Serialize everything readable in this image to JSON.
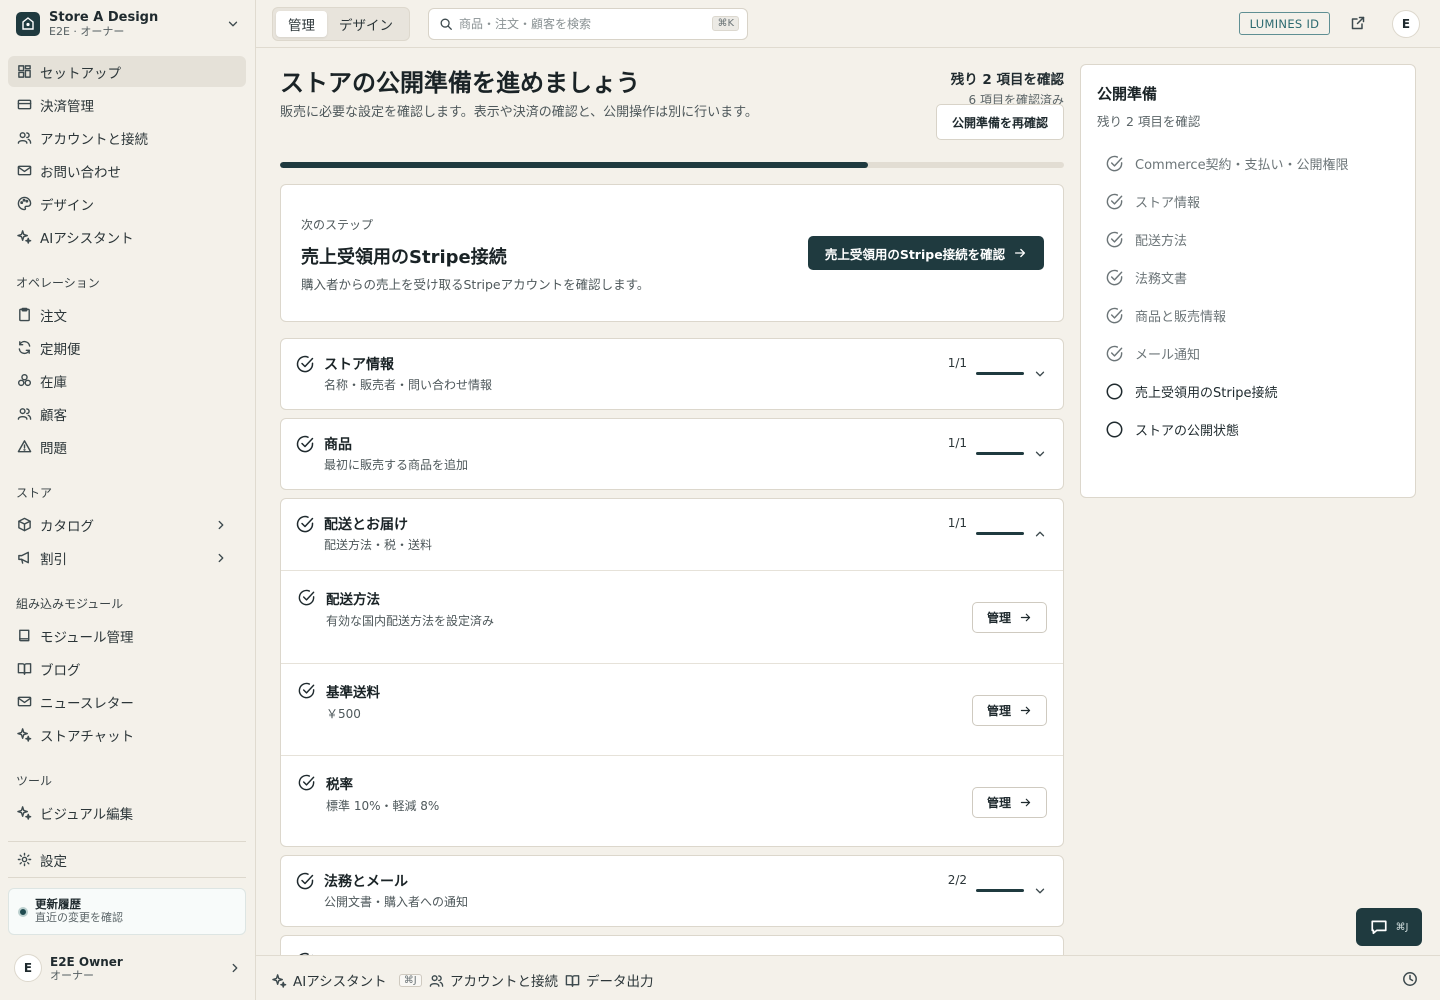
{
  "store": {
    "name": "Store A Design",
    "subtitle": "E2E · オーナー"
  },
  "sidebar": {
    "items": [
      {
        "label": "セットアップ"
      },
      {
        "label": "決済管理"
      },
      {
        "label": "アカウントと接続"
      },
      {
        "label": "お問い合わせ"
      },
      {
        "label": "デザイン"
      },
      {
        "label": "AIアシスタント"
      }
    ],
    "operations_heading": "オペレーション",
    "operations": [
      {
        "label": "注文"
      },
      {
        "label": "定期便"
      },
      {
        "label": "在庫"
      },
      {
        "label": "顧客"
      },
      {
        "label": "問題"
      }
    ],
    "store_heading": "ストア",
    "store_items": [
      {
        "label": "カタログ"
      },
      {
        "label": "割引"
      }
    ],
    "modules_heading": "組み込みモジュール",
    "modules": [
      {
        "label": "モジュール管理"
      },
      {
        "label": "ブログ"
      },
      {
        "label": "ニュースレター"
      },
      {
        "label": "ストアチャット"
      }
    ],
    "tools_heading": "ツール",
    "tools": [
      {
        "label": "ビジュアル編集"
      }
    ],
    "settings_label": "設定",
    "history": {
      "title": "更新履歴",
      "subtitle": "直近の変更を確認"
    },
    "user": {
      "initial": "E",
      "name": "E2E Owner",
      "role": "オーナー"
    }
  },
  "topbar": {
    "tabs": [
      {
        "label": "管理"
      },
      {
        "label": "デザイン"
      }
    ],
    "search_placeholder": "商品・注文・顧客を検索",
    "search_shortcut": "⌘K",
    "lumines_label": "LUMINES ID",
    "avatar_initial": "E"
  },
  "main": {
    "title": "ストアの公開準備を進めましょう",
    "subtitle": "販売に必要な設定を確認します。表示や決済の確認と、公開操作は別に行います。",
    "remaining": "残り 2 項目を確認",
    "confirmed": "6 項目を確認済み",
    "recheck_label": "公開準備を再確認",
    "progress": 0.75,
    "next_step": {
      "label": "次のステップ",
      "title": "売上受領用のStripe接続",
      "subtitle": "購入者からの売上を受け取るStripeアカウントを確認します。",
      "button": "売上受領用のStripe接続を確認"
    },
    "sections": [
      {
        "title": "ストア情報",
        "subtitle": "名称・販売者・問い合わせ情報",
        "count": "1/1"
      },
      {
        "title": "商品",
        "subtitle": "最初に販売する商品を追加",
        "count": "1/1"
      },
      {
        "title": "配送とお届け",
        "subtitle": "配送方法・税・送料",
        "count": "1/1",
        "items": [
          {
            "title": "配送方法",
            "subtitle": "有効な国内配送方法を設定済み",
            "button": "管理"
          },
          {
            "title": "基準送料",
            "subtitle": "￥500",
            "button": "管理"
          },
          {
            "title": "税率",
            "subtitle": "標準 10%・軽減 8%",
            "button": "管理"
          }
        ]
      },
      {
        "title": "法務とメール",
        "subtitle": "公開文書・購入者への通知",
        "count": "2/2"
      }
    ]
  },
  "panel": {
    "title": "公開準備",
    "subtitle": "残り 2 項目を確認",
    "items": [
      {
        "label": "Commerce契約・支払い・公開権限",
        "done": true
      },
      {
        "label": "ストア情報",
        "done": true
      },
      {
        "label": "配送方法",
        "done": true
      },
      {
        "label": "法務文書",
        "done": true
      },
      {
        "label": "商品と販売情報",
        "done": true
      },
      {
        "label": "メール通知",
        "done": true
      },
      {
        "label": "売上受領用のStripe接続",
        "done": false
      },
      {
        "label": "ストアの公開状態",
        "done": false
      }
    ]
  },
  "bottombar": {
    "ai_label": "AIアシスタント",
    "ai_shortcut": "⌘J",
    "account_label": "アカウントと接続",
    "export_label": "データ出力"
  },
  "chat_fab": {
    "shortcut": "⌘J"
  }
}
